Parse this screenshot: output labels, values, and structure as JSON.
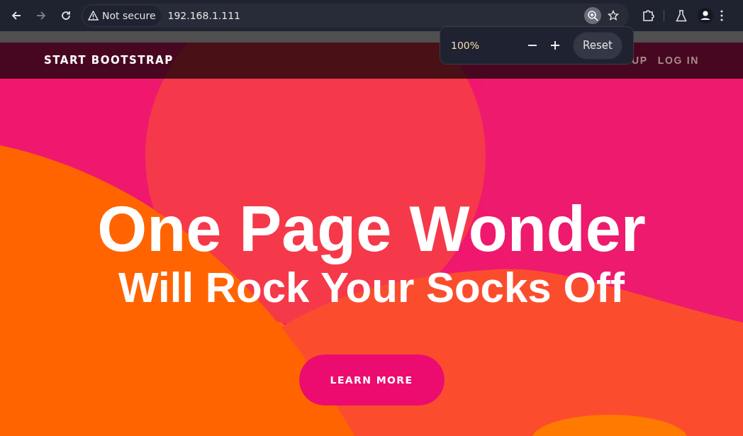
{
  "browser": {
    "security_label": "Not secure",
    "url": "192.168.1.111"
  },
  "zoom_popup": {
    "zoom_level": "100%",
    "reset_button": "Reset"
  },
  "navbar": {
    "brand": "START BOOTSTRAP",
    "links": [
      "UP",
      "LOG IN"
    ]
  },
  "hero": {
    "title": "One Page Wonder",
    "subtitle": "Will Rock Your Socks Off",
    "button": "LEARN MORE"
  }
}
